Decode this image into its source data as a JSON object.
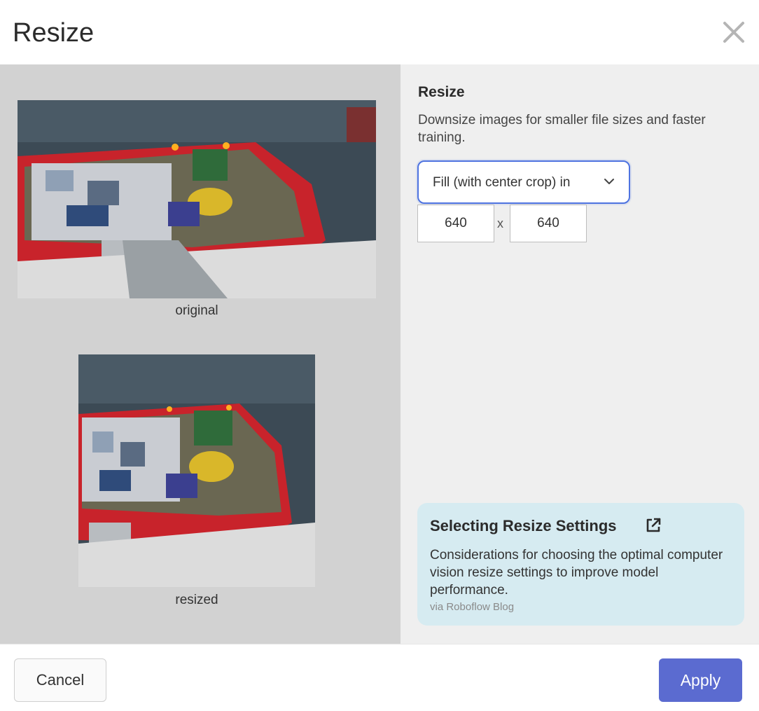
{
  "dialog": {
    "title": "Resize",
    "close_icon": "close-icon"
  },
  "preview": {
    "original_caption": "original",
    "resized_caption": "resized"
  },
  "settings": {
    "title": "Resize",
    "description": "Downsize images for smaller file sizes and faster training.",
    "mode_selected": "Fill (with center crop) in",
    "width": "640",
    "separator": "x",
    "height": "640"
  },
  "info_card": {
    "title": "Selecting Resize Settings",
    "icon": "external-link-icon",
    "description": "Considerations for choosing the optimal computer vision resize settings to improve model performance.",
    "source": "via Roboflow Blog"
  },
  "footer": {
    "cancel_label": "Cancel",
    "apply_label": "Apply"
  },
  "colors": {
    "primary": "#5b6bd0",
    "focus_border": "#4e73e0",
    "card_background": "#d6ebf1",
    "preview_background": "#d2d2d2",
    "settings_background": "#efefef"
  }
}
